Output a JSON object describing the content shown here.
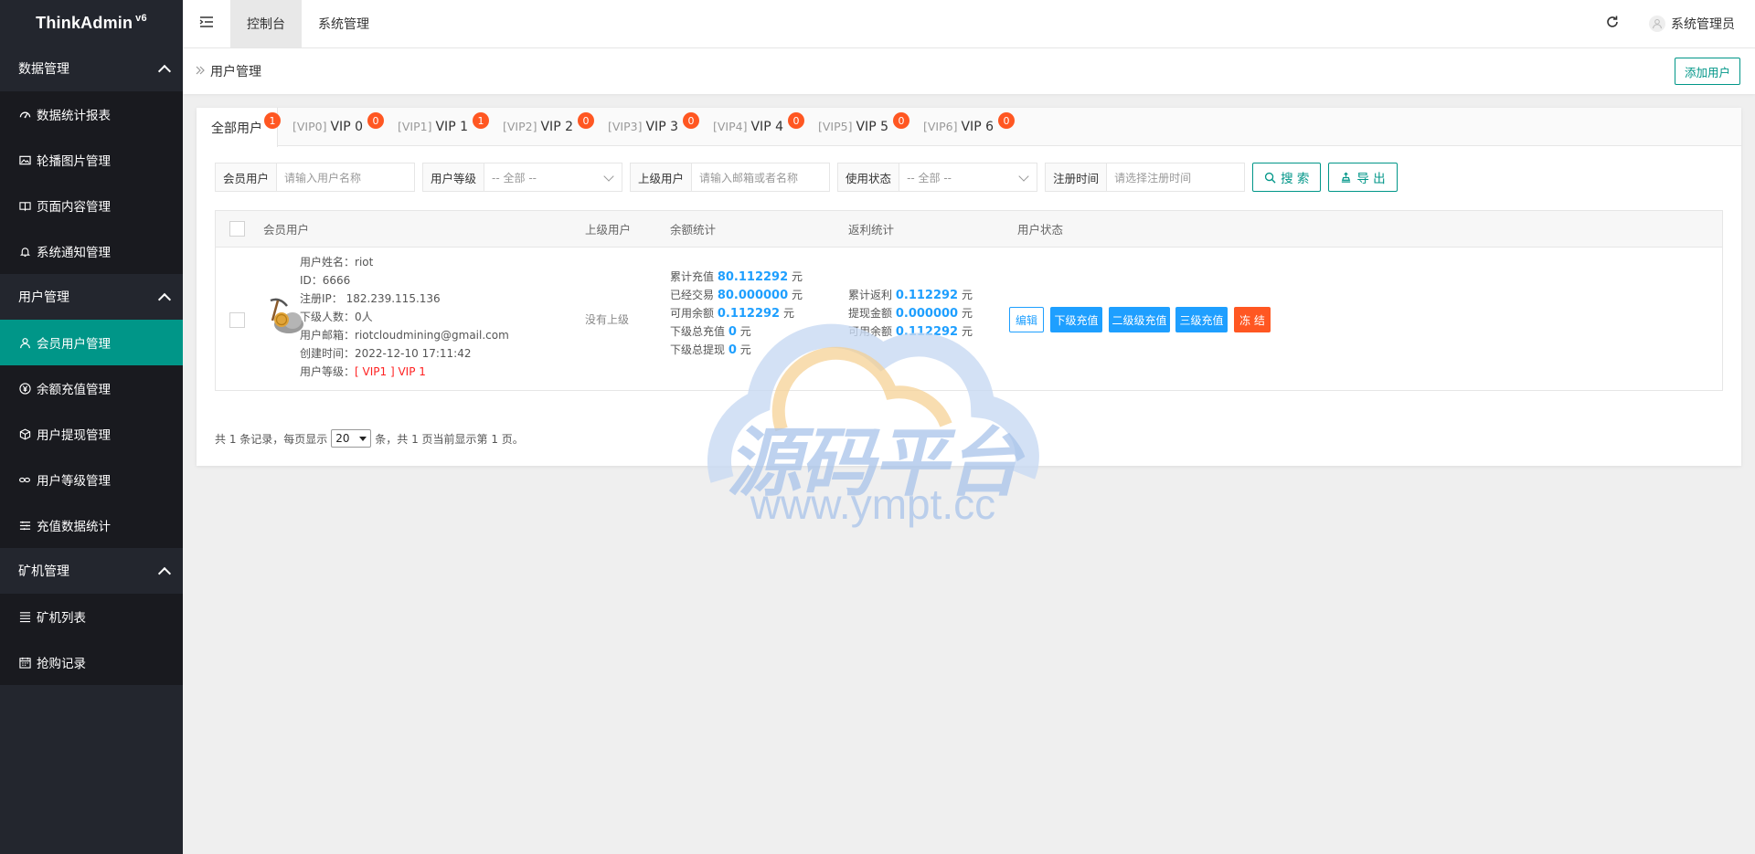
{
  "logo": {
    "name": "ThinkAdmin",
    "version": "v6"
  },
  "sidebar": {
    "groups": [
      {
        "label": "数据管理",
        "items": [
          {
            "icon": "dashboard-icon",
            "label": "数据统计报表"
          },
          {
            "icon": "image-icon",
            "label": "轮播图片管理"
          },
          {
            "icon": "book-icon",
            "label": "页面内容管理"
          },
          {
            "icon": "bell-icon",
            "label": "系统通知管理"
          }
        ]
      },
      {
        "label": "用户管理",
        "items": [
          {
            "icon": "user-icon",
            "label": "会员用户管理",
            "active": true
          },
          {
            "icon": "yen-icon",
            "label": "余额充值管理"
          },
          {
            "icon": "cube-icon",
            "label": "用户提现管理"
          },
          {
            "icon": "link-icon",
            "label": "用户等级管理"
          },
          {
            "icon": "list-icon",
            "label": "充值数据统计"
          }
        ]
      },
      {
        "label": "矿机管理",
        "items": [
          {
            "icon": "list-icon",
            "label": "矿机列表"
          },
          {
            "icon": "calendar-icon",
            "label": "抢购记录"
          }
        ]
      }
    ]
  },
  "topbar": {
    "tabs": [
      "控制台",
      "系统管理"
    ],
    "active_tab": "控制台",
    "user": "系统管理员"
  },
  "breadcrumb": {
    "label": "用户管理",
    "add_button": "添加用户"
  },
  "level_tabs": [
    {
      "prefix": "",
      "label": "全部用户",
      "count": "1"
    },
    {
      "prefix": "[VIP0]",
      "label": "VIP 0",
      "count": "0"
    },
    {
      "prefix": "[VIP1]",
      "label": "VIP 1",
      "count": "1"
    },
    {
      "prefix": "[VIP2]",
      "label": "VIP 2",
      "count": "0"
    },
    {
      "prefix": "[VIP3]",
      "label": "VIP 3",
      "count": "0"
    },
    {
      "prefix": "[VIP4]",
      "label": "VIP 4",
      "count": "0"
    },
    {
      "prefix": "[VIP5]",
      "label": "VIP 5",
      "count": "0"
    },
    {
      "prefix": "[VIP6]",
      "label": "VIP 6",
      "count": "0"
    }
  ],
  "filters": {
    "member": {
      "label": "会员用户",
      "placeholder": "请输入用户名称"
    },
    "level": {
      "label": "用户等级",
      "value": "-- 全部 --"
    },
    "parent": {
      "label": "上级用户",
      "placeholder": "请输入邮箱或者名称"
    },
    "status": {
      "label": "使用状态",
      "value": "-- 全部 --"
    },
    "register_time": {
      "label": "注册时间",
      "placeholder": "请选择注册时间"
    },
    "search_button": "搜 索",
    "export_button": "导 出"
  },
  "table": {
    "headers": [
      "会员用户",
      "上级用户",
      "余额统计",
      "返利统计",
      "用户状态"
    ],
    "rows": [
      {
        "info": {
          "name_label": "用户姓名：",
          "name": "riot",
          "id_label": "ID：",
          "id": "6666",
          "ip_label": "注册IP：",
          "ip": "182.239.115.136",
          "sub_label": "下级人数：",
          "sub": "0人",
          "email_label": "用户邮箱：",
          "email": "riotcloudmining@gmail.com",
          "created_label": "创建时间：",
          "created": "2022-12-10 17:11:42",
          "level_label": "用户等级：",
          "level": "[ VIP1 ] VIP 1"
        },
        "parent": "没有上级",
        "balance": [
          {
            "label": "累计充值",
            "value": "80.112292",
            "unit": "元"
          },
          {
            "label": "已经交易",
            "value": "80.000000",
            "unit": "元"
          },
          {
            "label": "可用余额",
            "value": "0.112292",
            "unit": "元"
          },
          {
            "label": "下级总充值",
            "value": "0",
            "unit": "元"
          },
          {
            "label": "下级总提现",
            "value": "0",
            "unit": "元"
          }
        ],
        "rebate": [
          {
            "label": "累计返利",
            "value": "0.112292",
            "unit": "元"
          },
          {
            "label": "提现金额",
            "value": "0.000000",
            "unit": "元"
          },
          {
            "label": "可用余额",
            "value": "0.112292",
            "unit": "元"
          }
        ],
        "actions": [
          "编辑",
          "下级充值",
          "二级级充值",
          "三级充值",
          "冻 结"
        ]
      }
    ]
  },
  "pagination": {
    "prefix": "共 1 条记录，每页显示",
    "page_size": "20",
    "suffix": "条，共 1 页当前显示第 1 页。"
  },
  "watermark": {
    "title": "源码平台",
    "url": "www.ympt.cc"
  },
  "colors": {
    "primary": "#009688",
    "sidebar": "#23262e",
    "blue": "#1e9fff",
    "badge": "#ff5722",
    "danger": "#ff5722"
  }
}
